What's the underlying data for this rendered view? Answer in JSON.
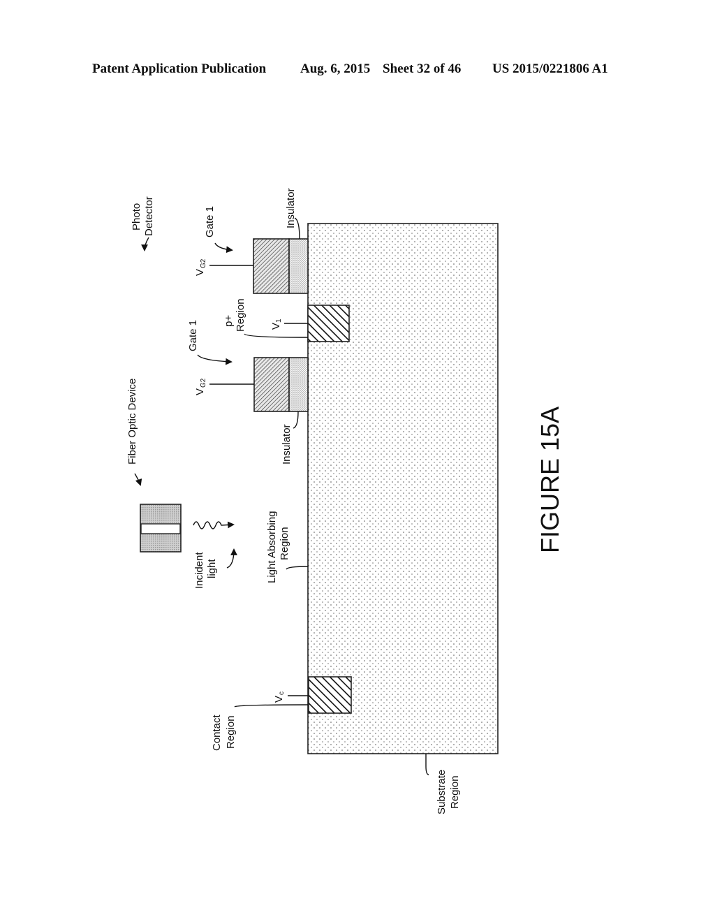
{
  "header": {
    "publication": "Patent Application Publication",
    "date": "Aug. 6, 2015",
    "sheet": "Sheet 32 of 46",
    "number": "US 2015/0221806 A1"
  },
  "figure": {
    "title": "FIGURE 15A",
    "labels": {
      "photo_detector_line1": "Photo",
      "photo_detector_line2": "Detector",
      "gate1_top": "Gate 1",
      "gate1_bottom": "Gate 1",
      "insulator_top": "Insulator",
      "insulator_bottom": "Insulator",
      "vg2_top": "V",
      "vg2_top_sub": "G2",
      "vg2_bottom": "V",
      "vg2_bottom_sub": "G2",
      "p_region_line1": "p+",
      "p_region_line2": "Region",
      "v1": "V",
      "v1_sub": "1",
      "fiber_optic_device": "Fiber Optic Device",
      "incident_light_line1": "Incident",
      "incident_light_line2": "light",
      "light_absorbing_line1": "Light Absorbing",
      "light_absorbing_line2": "Region",
      "vc": "V",
      "vc_sub": "c",
      "contact_region_line1": "Contact",
      "contact_region_line2": "Region",
      "substrate_region_line1": "Substrate",
      "substrate_region_line2": "Region"
    }
  }
}
